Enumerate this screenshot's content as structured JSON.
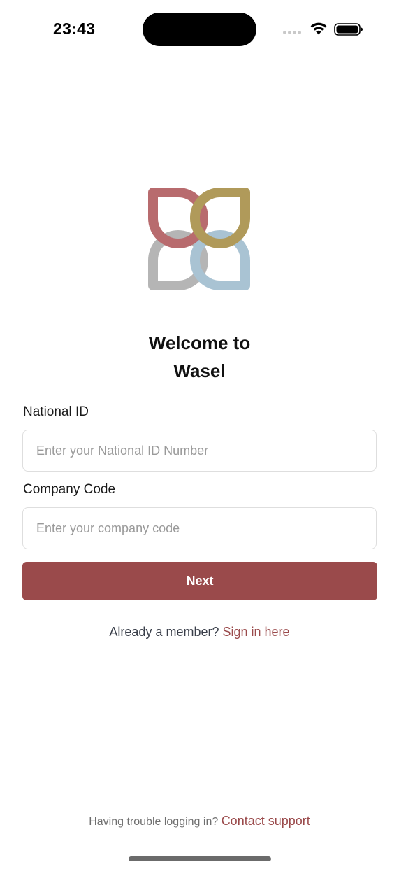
{
  "status_bar": {
    "time": "23:43",
    "signal_icon": "cellular-signal-icon",
    "wifi_icon": "wifi-icon",
    "battery_icon": "battery-icon"
  },
  "logo": {
    "icon": "wasel-logo",
    "colors": [
      "#b86b6e",
      "#b09a5a",
      "#b5b5b5",
      "#a9c3d3"
    ]
  },
  "welcome": {
    "line1": "Welcome to",
    "line2": "Wasel"
  },
  "form": {
    "national_id": {
      "label": "National ID",
      "value": "",
      "placeholder": "Enter your National ID Number"
    },
    "company_code": {
      "label": "Company Code",
      "value": "",
      "placeholder": "Enter your company code"
    },
    "next_label": "Next"
  },
  "member": {
    "prompt": "Already a member?",
    "link": "Sign in here"
  },
  "support": {
    "prompt": "Having trouble logging in?",
    "link": "Contact support"
  },
  "colors": {
    "accent": "#9a4a4b",
    "input_border": "#dedede",
    "placeholder": "#9a9a9a"
  }
}
